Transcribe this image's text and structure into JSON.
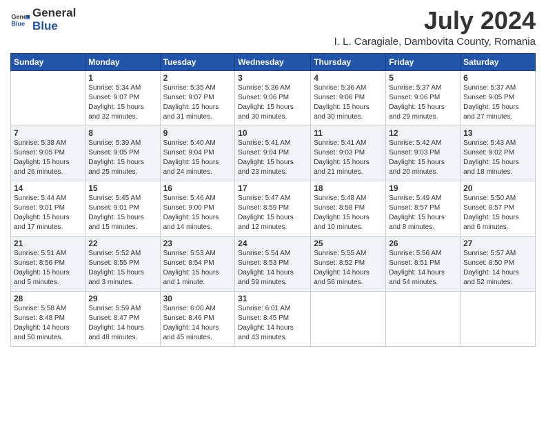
{
  "logo": {
    "general": "General",
    "blue": "Blue",
    "icon_color": "#2a6fcc"
  },
  "title": "July 2024",
  "location": "I. L. Caragiale, Dambovita County, Romania",
  "weekdays": [
    "Sunday",
    "Monday",
    "Tuesday",
    "Wednesday",
    "Thursday",
    "Friday",
    "Saturday"
  ],
  "weeks": [
    [
      {
        "day": "",
        "info": ""
      },
      {
        "day": "1",
        "info": "Sunrise: 5:34 AM\nSunset: 9:07 PM\nDaylight: 15 hours\nand 32 minutes."
      },
      {
        "day": "2",
        "info": "Sunrise: 5:35 AM\nSunset: 9:07 PM\nDaylight: 15 hours\nand 31 minutes."
      },
      {
        "day": "3",
        "info": "Sunrise: 5:36 AM\nSunset: 9:06 PM\nDaylight: 15 hours\nand 30 minutes."
      },
      {
        "day": "4",
        "info": "Sunrise: 5:36 AM\nSunset: 9:06 PM\nDaylight: 15 hours\nand 30 minutes."
      },
      {
        "day": "5",
        "info": "Sunrise: 5:37 AM\nSunset: 9:06 PM\nDaylight: 15 hours\nand 29 minutes."
      },
      {
        "day": "6",
        "info": "Sunrise: 5:37 AM\nSunset: 9:05 PM\nDaylight: 15 hours\nand 27 minutes."
      }
    ],
    [
      {
        "day": "7",
        "info": "Sunrise: 5:38 AM\nSunset: 9:05 PM\nDaylight: 15 hours\nand 26 minutes."
      },
      {
        "day": "8",
        "info": "Sunrise: 5:39 AM\nSunset: 9:05 PM\nDaylight: 15 hours\nand 25 minutes."
      },
      {
        "day": "9",
        "info": "Sunrise: 5:40 AM\nSunset: 9:04 PM\nDaylight: 15 hours\nand 24 minutes."
      },
      {
        "day": "10",
        "info": "Sunrise: 5:41 AM\nSunset: 9:04 PM\nDaylight: 15 hours\nand 23 minutes."
      },
      {
        "day": "11",
        "info": "Sunrise: 5:41 AM\nSunset: 9:03 PM\nDaylight: 15 hours\nand 21 minutes."
      },
      {
        "day": "12",
        "info": "Sunrise: 5:42 AM\nSunset: 9:03 PM\nDaylight: 15 hours\nand 20 minutes."
      },
      {
        "day": "13",
        "info": "Sunrise: 5:43 AM\nSunset: 9:02 PM\nDaylight: 15 hours\nand 18 minutes."
      }
    ],
    [
      {
        "day": "14",
        "info": "Sunrise: 5:44 AM\nSunset: 9:01 PM\nDaylight: 15 hours\nand 17 minutes."
      },
      {
        "day": "15",
        "info": "Sunrise: 5:45 AM\nSunset: 9:01 PM\nDaylight: 15 hours\nand 15 minutes."
      },
      {
        "day": "16",
        "info": "Sunrise: 5:46 AM\nSunset: 9:00 PM\nDaylight: 15 hours\nand 14 minutes."
      },
      {
        "day": "17",
        "info": "Sunrise: 5:47 AM\nSunset: 8:59 PM\nDaylight: 15 hours\nand 12 minutes."
      },
      {
        "day": "18",
        "info": "Sunrise: 5:48 AM\nSunset: 8:58 PM\nDaylight: 15 hours\nand 10 minutes."
      },
      {
        "day": "19",
        "info": "Sunrise: 5:49 AM\nSunset: 8:57 PM\nDaylight: 15 hours\nand 8 minutes."
      },
      {
        "day": "20",
        "info": "Sunrise: 5:50 AM\nSunset: 8:57 PM\nDaylight: 15 hours\nand 6 minutes."
      }
    ],
    [
      {
        "day": "21",
        "info": "Sunrise: 5:51 AM\nSunset: 8:56 PM\nDaylight: 15 hours\nand 5 minutes."
      },
      {
        "day": "22",
        "info": "Sunrise: 5:52 AM\nSunset: 8:55 PM\nDaylight: 15 hours\nand 3 minutes."
      },
      {
        "day": "23",
        "info": "Sunrise: 5:53 AM\nSunset: 8:54 PM\nDaylight: 15 hours\nand 1 minute."
      },
      {
        "day": "24",
        "info": "Sunrise: 5:54 AM\nSunset: 8:53 PM\nDaylight: 14 hours\nand 59 minutes."
      },
      {
        "day": "25",
        "info": "Sunrise: 5:55 AM\nSunset: 8:52 PM\nDaylight: 14 hours\nand 56 minutes."
      },
      {
        "day": "26",
        "info": "Sunrise: 5:56 AM\nSunset: 8:51 PM\nDaylight: 14 hours\nand 54 minutes."
      },
      {
        "day": "27",
        "info": "Sunrise: 5:57 AM\nSunset: 8:50 PM\nDaylight: 14 hours\nand 52 minutes."
      }
    ],
    [
      {
        "day": "28",
        "info": "Sunrise: 5:58 AM\nSunset: 8:48 PM\nDaylight: 14 hours\nand 50 minutes."
      },
      {
        "day": "29",
        "info": "Sunrise: 5:59 AM\nSunset: 8:47 PM\nDaylight: 14 hours\nand 48 minutes."
      },
      {
        "day": "30",
        "info": "Sunrise: 6:00 AM\nSunset: 8:46 PM\nDaylight: 14 hours\nand 45 minutes."
      },
      {
        "day": "31",
        "info": "Sunrise: 6:01 AM\nSunset: 8:45 PM\nDaylight: 14 hours\nand 43 minutes."
      },
      {
        "day": "",
        "info": ""
      },
      {
        "day": "",
        "info": ""
      },
      {
        "day": "",
        "info": ""
      }
    ]
  ]
}
